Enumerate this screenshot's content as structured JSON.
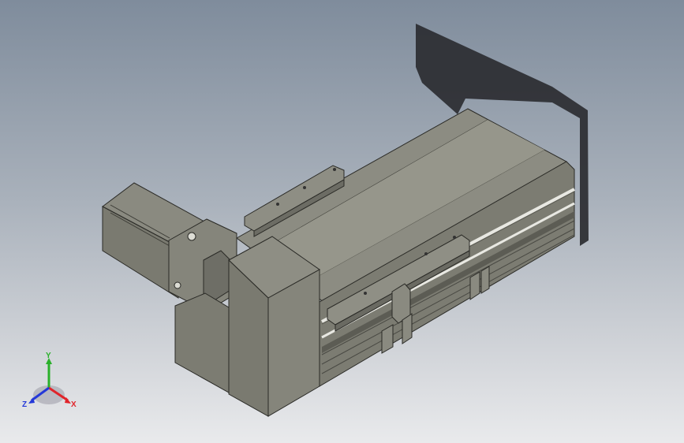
{
  "viewport": {
    "background_top": "#7f8c9c",
    "background_bottom": "#e9eaec"
  },
  "model": {
    "body_color": "#8a8a7e",
    "edge_color": "#2a2a26",
    "shadow_color": "#2b2d31"
  },
  "triad": {
    "x_label": "X",
    "y_label": "Y",
    "z_label": "Z",
    "x_color": "#e0242a",
    "y_color": "#2ab02a",
    "z_color": "#2438d8"
  }
}
